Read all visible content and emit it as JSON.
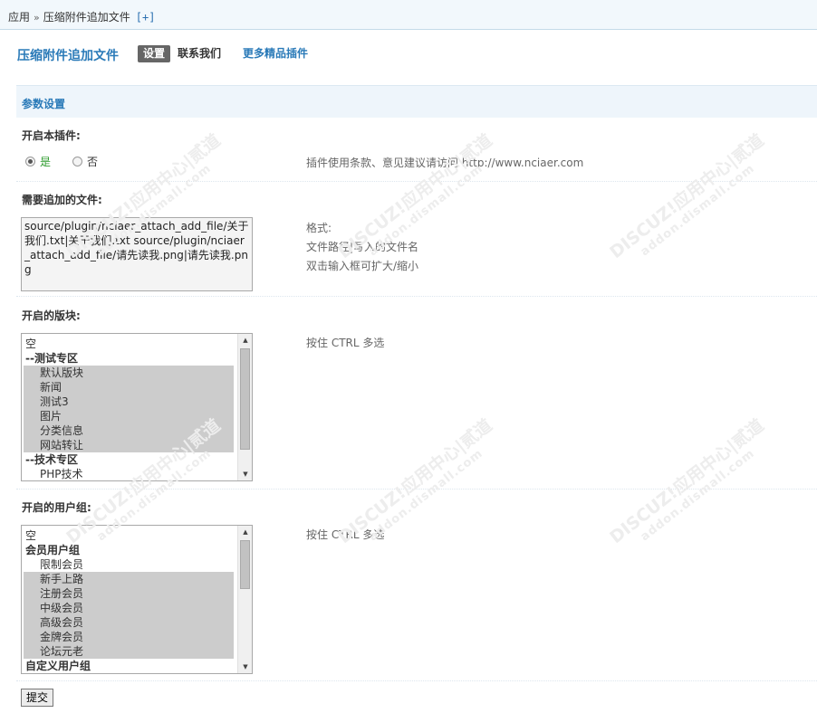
{
  "breadcrumb": {
    "root": "应用",
    "separator": "»",
    "current": "压缩附件追加文件",
    "add": "[+]"
  },
  "plugin": {
    "title": "压缩附件追加文件"
  },
  "tabs": [
    {
      "label": "设置",
      "active": true
    },
    {
      "label": "联系我们",
      "active": false
    },
    {
      "label": "更多精品插件",
      "active": false
    }
  ],
  "section": {
    "title": "参数设置"
  },
  "settings": {
    "enable": {
      "label": "开启本插件:",
      "yes": "是",
      "no": "否",
      "selected": "yes",
      "hint": "插件使用条款、意见建议请访问 http://www.nciaer.com"
    },
    "files": {
      "label": "需要追加的文件:",
      "value": "source/plugin/nciaer_attach_add_file/关于我们.txt|关于我们.txt\nsource/plugin/nciaer_attach_add_file/请先读我.png|请先读我.png",
      "hint_lines": [
        "格式:",
        "文件路径|写入的文件名",
        "双击输入框可扩大/缩小"
      ]
    },
    "forums": {
      "label": "开启的版块:",
      "hint": "按住 CTRL 多选",
      "options": [
        {
          "text": "空",
          "kind": "plain",
          "selected": false
        },
        {
          "text": "--测试专区",
          "kind": "group",
          "selected": false
        },
        {
          "text": "默认版块",
          "kind": "item",
          "selected": true
        },
        {
          "text": "新闻",
          "kind": "item",
          "selected": true
        },
        {
          "text": "测试3",
          "kind": "item",
          "selected": true
        },
        {
          "text": "图片",
          "kind": "item",
          "selected": true
        },
        {
          "text": "分类信息",
          "kind": "item",
          "selected": true
        },
        {
          "text": "网站转让",
          "kind": "item",
          "selected": true
        },
        {
          "text": "--技术专区",
          "kind": "group",
          "selected": false
        },
        {
          "text": "PHP技术",
          "kind": "item",
          "selected": false
        }
      ]
    },
    "usergroups": {
      "label": "开启的用户组:",
      "hint": "按住 CTRL 多选",
      "options": [
        {
          "text": "空",
          "kind": "plain",
          "selected": false
        },
        {
          "text": "会员用户组",
          "kind": "group",
          "selected": false
        },
        {
          "text": "限制会员",
          "kind": "item",
          "selected": false
        },
        {
          "text": "新手上路",
          "kind": "item",
          "selected": true
        },
        {
          "text": "注册会员",
          "kind": "item",
          "selected": true
        },
        {
          "text": "中级会员",
          "kind": "item",
          "selected": true
        },
        {
          "text": "高级会员",
          "kind": "item",
          "selected": true
        },
        {
          "text": "金牌会员",
          "kind": "item",
          "selected": true
        },
        {
          "text": "论坛元老",
          "kind": "item",
          "selected": true
        },
        {
          "text": "自定义用户组",
          "kind": "group",
          "selected": false
        }
      ]
    }
  },
  "submit": {
    "label": "提交"
  },
  "watermark": {
    "brand": "DISCUZ!应用中心|贰道",
    "domain": "addon.dismall.com"
  }
}
